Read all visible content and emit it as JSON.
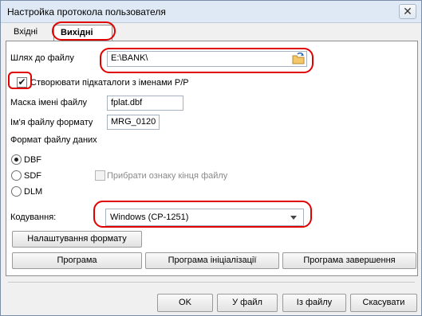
{
  "window": {
    "title": "Настройка протокола пользователя"
  },
  "tabs": [
    {
      "label": "Вхідні",
      "active": false
    },
    {
      "label": "Вихідні",
      "active": true
    }
  ],
  "form": {
    "file_path_label": "Шлях до файлу",
    "file_path_value": "E:\\BANK\\",
    "create_subdirs_label": "Створювати підкаталоги з іменами Р/Р",
    "create_subdirs_checked": true,
    "name_mask_label": "Маска імені файлу",
    "name_mask_value": "fplat.dbf",
    "format_file_name_label": "Ім'я файлу формату",
    "format_file_name_value": "MRG_0120",
    "data_format_label": "Формат файлу даних",
    "formats": [
      {
        "label": "DBF",
        "selected": true
      },
      {
        "label": "SDF",
        "selected": false
      },
      {
        "label": "DLM",
        "selected": false
      }
    ],
    "remove_eof_label": "Прибрати ознаку кінця файлу",
    "encoding_label": "Кодування:",
    "encoding_value": "Windows (CP-1251)",
    "format_settings_button": "Налаштування формату",
    "program_button": "Програма",
    "init_program_button": "Програма ініціалізації",
    "finish_program_button": "Програма завершення"
  },
  "footer": {
    "ok": "OK",
    "to_file": "У файл",
    "from_file": "Із файлу",
    "cancel": "Скасувати"
  },
  "colors": {
    "highlight": "#e00000",
    "background": "#f0f0f0"
  }
}
